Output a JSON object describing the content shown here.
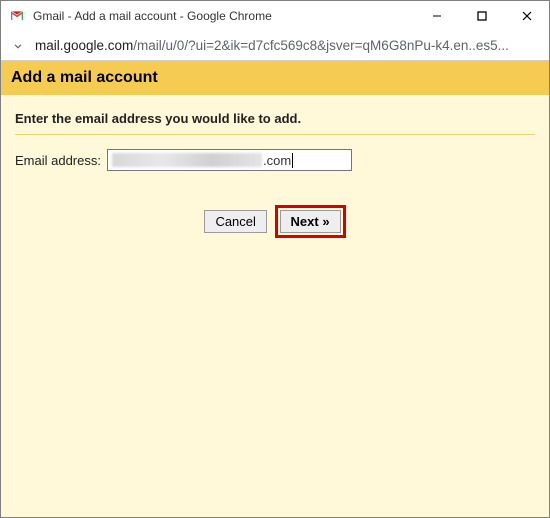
{
  "window": {
    "title": "Gmail - Add a mail account - Google Chrome"
  },
  "browser": {
    "url_host": "mail.google.com",
    "url_path": "/mail/u/0/?ui=2&ik=d7cfc569c8&jsver=qM6G8nPu-k4.en..es5..."
  },
  "page": {
    "header": "Add a mail account",
    "prompt": "Enter the email address you would like to add.",
    "email_label": "Email address:",
    "email_suffix": ".com",
    "buttons": {
      "cancel": "Cancel",
      "next": "Next »"
    }
  }
}
